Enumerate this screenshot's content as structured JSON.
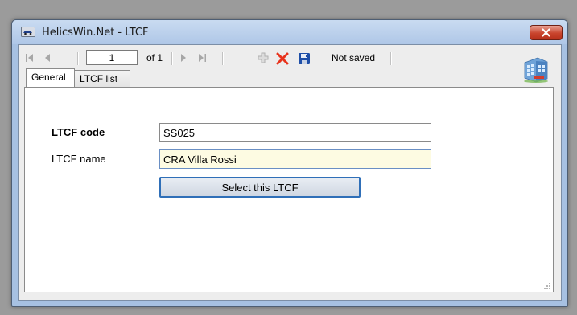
{
  "window": {
    "title": "HelicsWin.Net - LTCF",
    "icons": {
      "app": "car-icon",
      "close": "close-icon",
      "building": "building-icon"
    }
  },
  "toolbar": {
    "position_value": "1",
    "of_label": "of 1",
    "status_text": "Not saved",
    "icons": [
      "first-record-icon",
      "prev-record-icon",
      "next-record-icon",
      "last-record-icon",
      "add-icon",
      "delete-icon",
      "save-icon"
    ],
    "colors": {
      "delete": "#e8331c",
      "save": "#1f4fa8"
    }
  },
  "tabs": [
    {
      "label": "General",
      "active": true
    },
    {
      "label": "LTCF list",
      "active": false
    }
  ],
  "form": {
    "code_label": "LTCF code",
    "code_value": "SS025",
    "name_label": "LTCF name",
    "name_value": "CRA Villa Rossi",
    "select_button": "Select this LTCF"
  }
}
